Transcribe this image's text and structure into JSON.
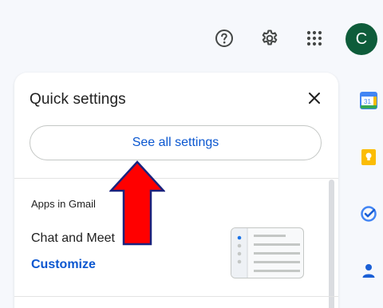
{
  "topbar": {
    "help_icon": "help-circle-icon",
    "settings_icon": "gear-icon",
    "apps_icon": "apps-grid-icon",
    "avatar_letter": "C",
    "avatar_color": "#0e5c3a"
  },
  "right_rail": {
    "items": [
      {
        "icon": "calendar-icon",
        "label": "31"
      },
      {
        "icon": "keep-icon"
      },
      {
        "icon": "tasks-icon"
      },
      {
        "icon": "contacts-icon"
      }
    ]
  },
  "quick_settings": {
    "title": "Quick settings",
    "close_icon": "close-icon",
    "see_all_label": "See all settings",
    "section_heading": "Apps in Gmail",
    "chat_meet_label": "Chat and Meet",
    "customize_label": "Customize"
  },
  "annotation": {
    "arrow_color": "#ff0000",
    "arrow_direction": "up"
  },
  "colors": {
    "link_blue": "#0b57d0",
    "background": "#f6f8fc"
  }
}
